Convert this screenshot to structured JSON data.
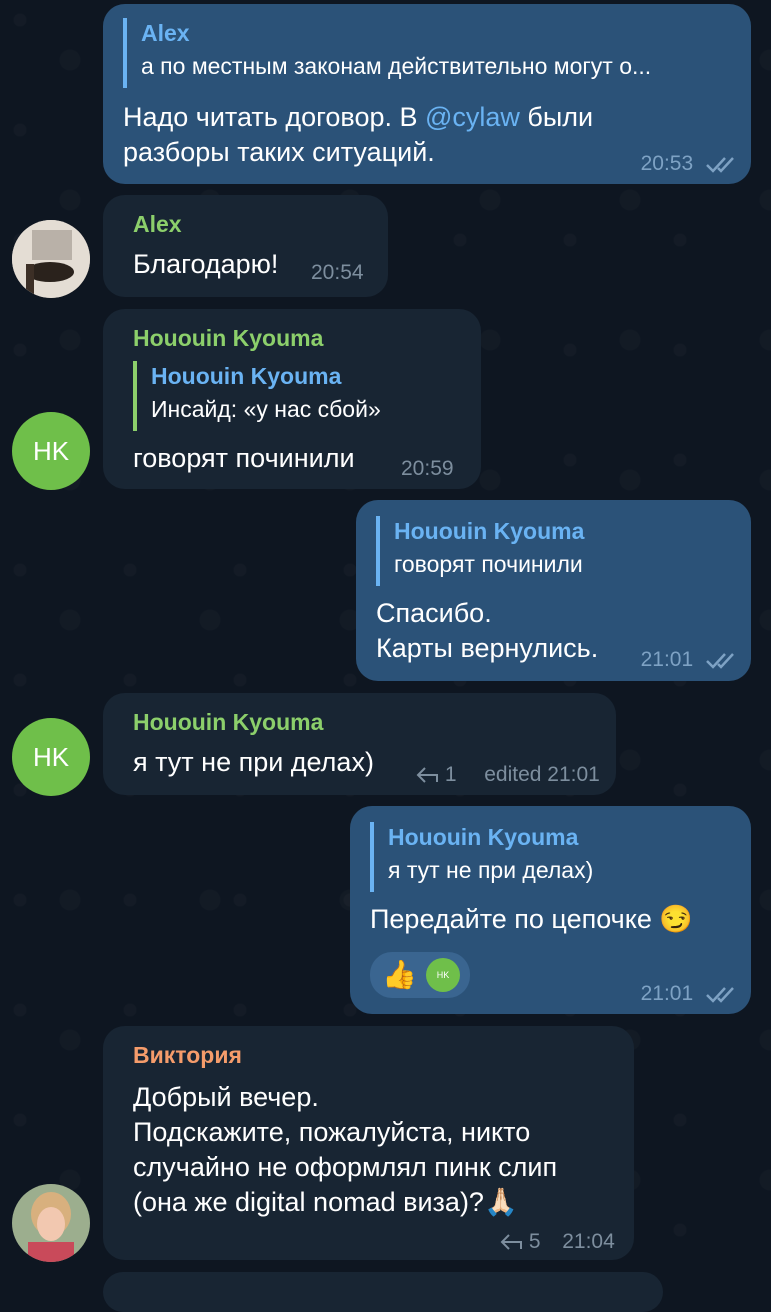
{
  "messages": [
    {
      "quote_name": "Alex",
      "quote_text": "а по местным законам действительно могут о...",
      "text_line1_before": "Надо читать договор. В ",
      "mention": "@cylaw",
      "text_line1_after": " были",
      "text_line2": "разборы таких ситуаций.",
      "time": "20:53"
    },
    {
      "sender": "Alex",
      "text": "Благодарю!",
      "time": "20:54"
    },
    {
      "sender": "Hououin Kyouma",
      "quote_name": "Hououin Kyouma",
      "quote_text": "Инсайд: «у нас сбой»",
      "text": "говорят починили",
      "time": "20:59",
      "avatar": "HK"
    },
    {
      "quote_name": "Hououin Kyouma",
      "quote_text": "говорят починили",
      "text_line1": "Спасибо.",
      "text_line2": "Карты вернулись.",
      "time": "21:01"
    },
    {
      "sender": "Hououin Kyouma",
      "text": "я тут не при делах)",
      "replies": "1",
      "time": "edited 21:01",
      "avatar": "HK"
    },
    {
      "quote_name": "Hououin Kyouma",
      "quote_text": "я тут не при делах)",
      "text": "Передайте по цепочке 😏",
      "reaction_emoji": "👍",
      "reaction_avatar": "HK",
      "time": "21:01"
    },
    {
      "sender": "Виктория",
      "line1": "Добрый вечер.",
      "line2": "Подскажите, пожалуйста, никто",
      "line3": "случайно не оформлял пинк слип",
      "line4": "(она же digital nomad виза)?🙏🏻",
      "replies": "5",
      "time": "21:04"
    }
  ],
  "colors": {
    "background": "#0e1621",
    "outgoing_bubble": "#2b5278",
    "incoming_bubble": "#182533",
    "accent_blue": "#6ab3f3",
    "sender_green": "#8ccf6b",
    "sender_orange": "#f59c6b"
  }
}
